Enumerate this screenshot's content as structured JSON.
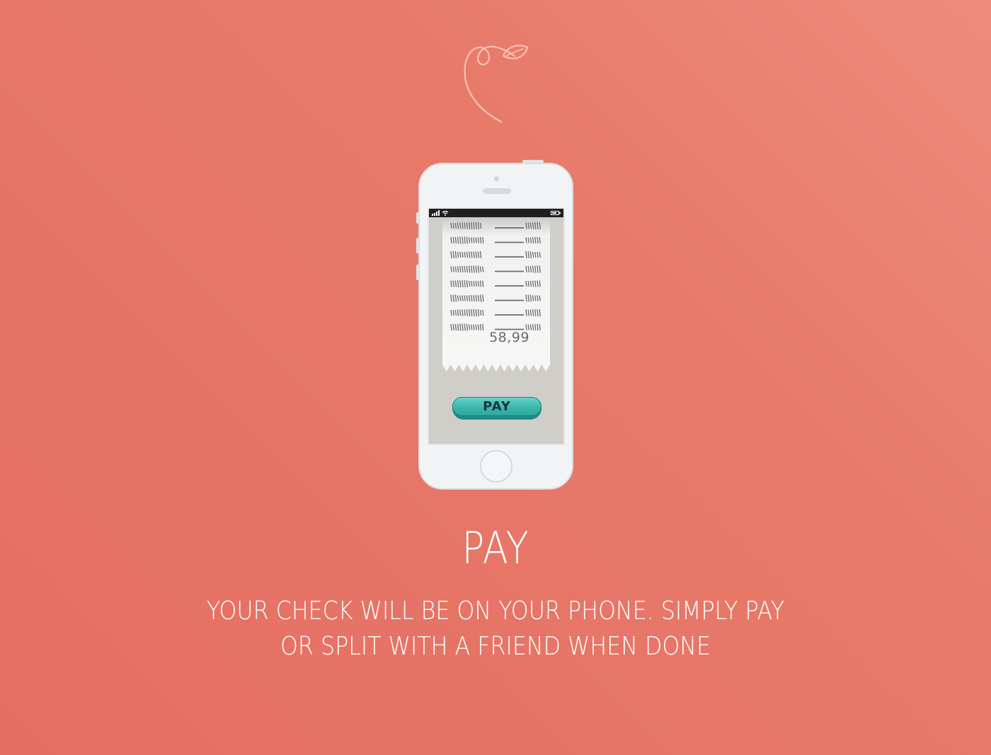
{
  "colors": {
    "background_start": "#ed8c7b",
    "background_end": "#e56e62",
    "text": "#ffffff",
    "pay_button": "#3cb7ad",
    "receipt_paper": "#f4f4f3",
    "screen_bg": "#cfcec8"
  },
  "logo": {
    "icon": "leaf-sprout-icon"
  },
  "phone": {
    "receipt": {
      "total": "58,99",
      "line_count": 8
    },
    "pay_button_label": "PAY"
  },
  "title": "PAY",
  "description": {
    "line1": "YOUR CHECK WILL BE ON YOUR PHONE. SIMPLY PAY",
    "line2": "OR SPLIT WITH A FRIEND WHEN DONE"
  }
}
